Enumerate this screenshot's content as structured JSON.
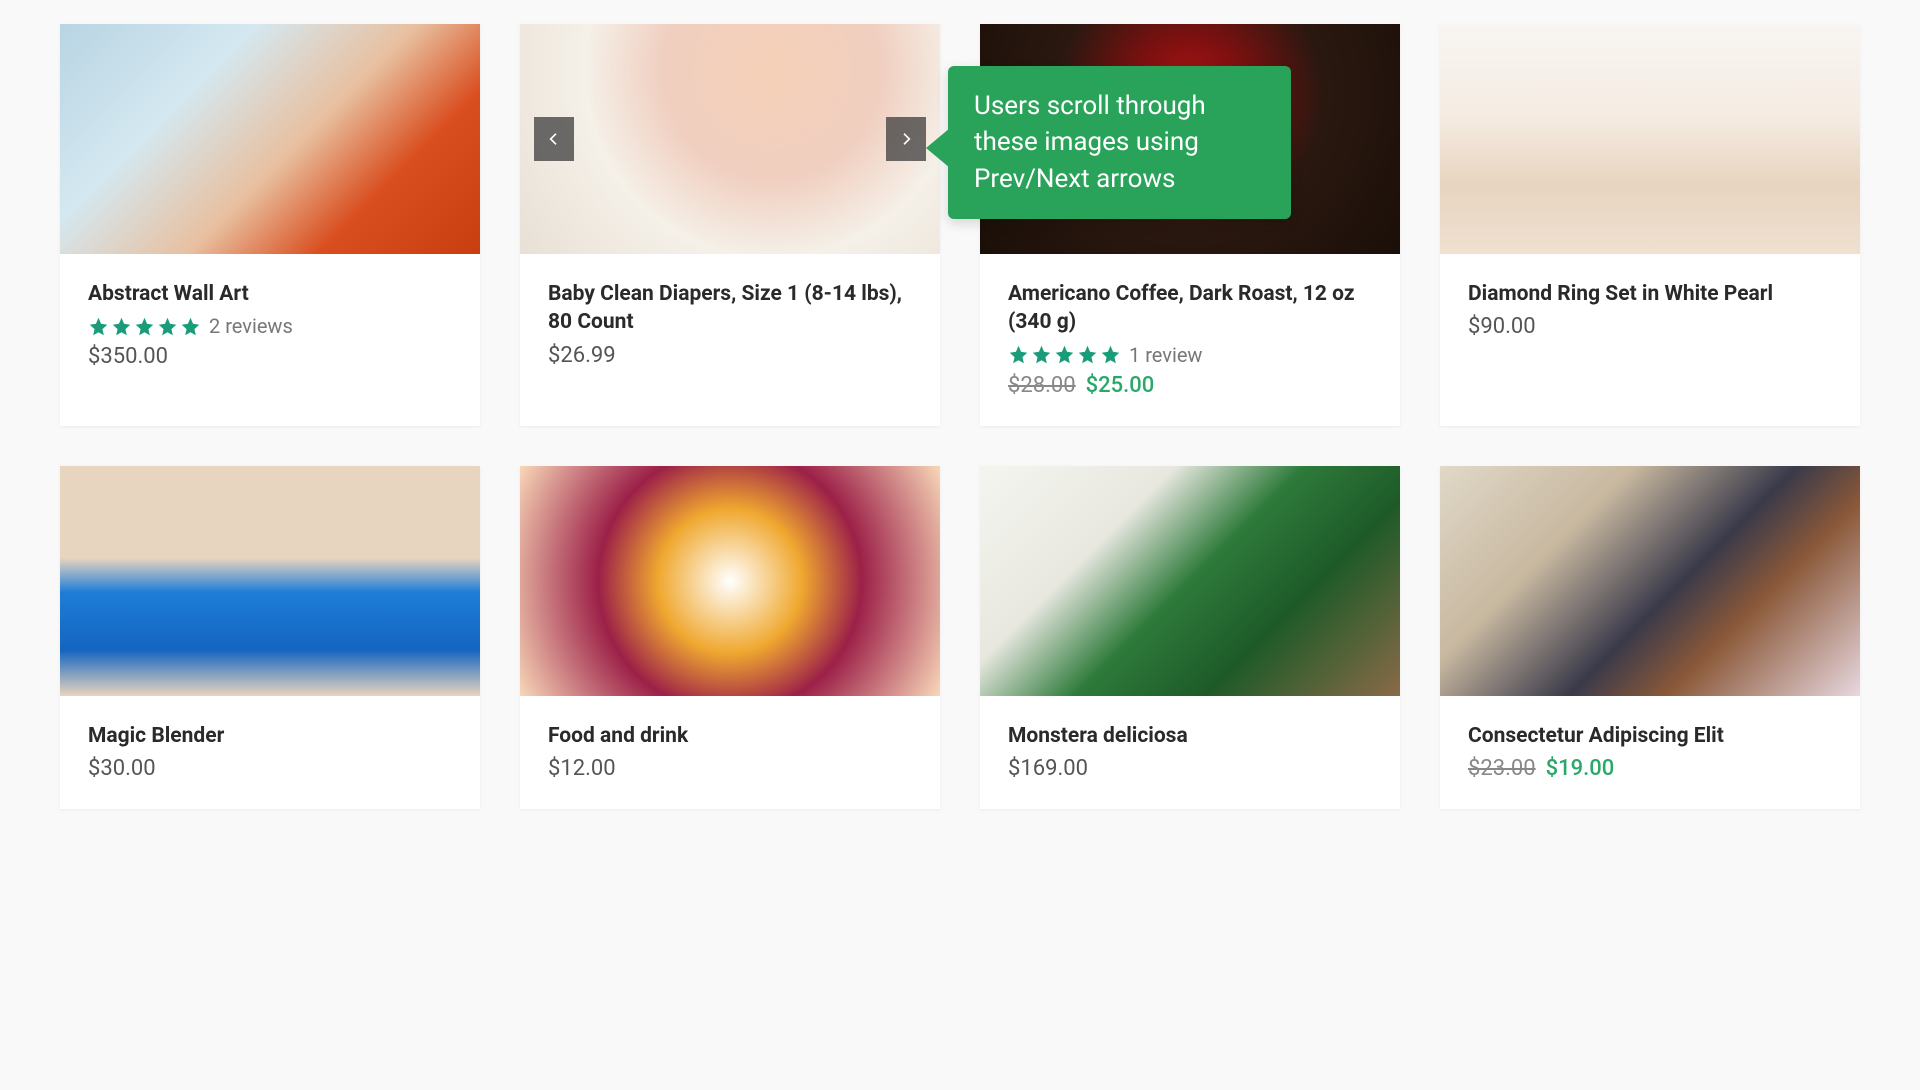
{
  "tooltip": {
    "text": "Users scroll through these images using Prev/Next arrows"
  },
  "colors": {
    "star": "#1a9c7a",
    "sale": "#2aa86a",
    "tooltip": "#2aa35a"
  },
  "products": [
    {
      "title": "Abstract Wall Art",
      "rating": 5,
      "reviews_label": "2 reviews",
      "price": "$350.00",
      "old_price": null,
      "sale_price": null,
      "has_carousel": false
    },
    {
      "title": "Baby Clean Diapers, Size 1 (8-14 lbs), 80 Count",
      "rating": null,
      "reviews_label": null,
      "price": "$26.99",
      "old_price": null,
      "sale_price": null,
      "has_carousel": true
    },
    {
      "title": "Americano Coffee, Dark Roast, 12 oz (340 g)",
      "rating": 5,
      "reviews_label": "1 review",
      "price": null,
      "old_price": "$28.00",
      "sale_price": "$25.00",
      "has_carousel": false
    },
    {
      "title": "Diamond Ring Set in White Pearl",
      "rating": null,
      "reviews_label": null,
      "price": "$90.00",
      "old_price": null,
      "sale_price": null,
      "has_carousel": false
    },
    {
      "title": "Magic Blender",
      "rating": null,
      "reviews_label": null,
      "price": "$30.00",
      "old_price": null,
      "sale_price": null,
      "has_carousel": false
    },
    {
      "title": "Food and drink",
      "rating": null,
      "reviews_label": null,
      "price": "$12.00",
      "old_price": null,
      "sale_price": null,
      "has_carousel": false
    },
    {
      "title": "Monstera deliciosa",
      "rating": null,
      "reviews_label": null,
      "price": "$169.00",
      "old_price": null,
      "sale_price": null,
      "has_carousel": false
    },
    {
      "title": "Consectetur Adipiscing Elit",
      "rating": null,
      "reviews_label": null,
      "price": null,
      "old_price": "$23.00",
      "sale_price": "$19.00",
      "has_carousel": false
    }
  ]
}
